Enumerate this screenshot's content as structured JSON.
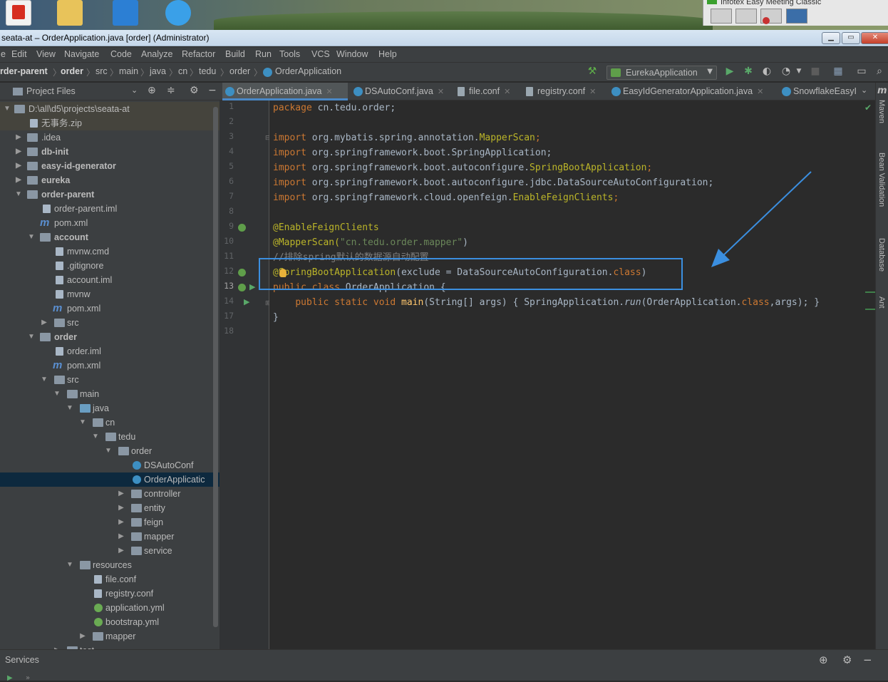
{
  "window": {
    "title": "seata-at – OrderApplication.java [order] (Administrator)",
    "meeting_app_title": "Infotex Easy Meeting Classic"
  },
  "menu": [
    "e",
    "Edit",
    "View",
    "Navigate",
    "Code",
    "Analyze",
    "Refactor",
    "Build",
    "Run",
    "Tools",
    "VCS",
    "Window",
    "Help"
  ],
  "breadcrumb": [
    "rder-parent",
    "order",
    "src",
    "main",
    "java",
    "cn",
    "tedu",
    "order",
    "OrderApplication"
  ],
  "run_config": "EurekaApplication",
  "project_panel": {
    "title": "Project Files"
  },
  "tabs": [
    "OrderApplication.java",
    "DSAutoConf.java",
    "file.conf",
    "registry.conf",
    "EasyIdGeneratorApplication.java",
    "SnowflakeEasyI"
  ],
  "tree": [
    {
      "label": "D:\\all\\d5\\projects\\seata-at",
      "bold": false
    },
    {
      "label": "无事务.zip",
      "bold": false
    },
    {
      "label": ".idea",
      "bold": false
    },
    {
      "label": "db-init",
      "bold": true
    },
    {
      "label": "easy-id-generator",
      "bold": true
    },
    {
      "label": "eureka",
      "bold": true
    },
    {
      "label": "order-parent",
      "bold": true
    },
    {
      "label": "order-parent.iml",
      "bold": false
    },
    {
      "label": "pom.xml",
      "bold": false
    },
    {
      "label": "account",
      "bold": true
    },
    {
      "label": "mvnw.cmd",
      "bold": false
    },
    {
      "label": ".gitignore",
      "bold": false
    },
    {
      "label": "account.iml",
      "bold": false
    },
    {
      "label": "mvnw",
      "bold": false
    },
    {
      "label": "pom.xml",
      "bold": false
    },
    {
      "label": "src",
      "bold": false
    },
    {
      "label": "order",
      "bold": true
    },
    {
      "label": "order.iml",
      "bold": false
    },
    {
      "label": "pom.xml",
      "bold": false
    },
    {
      "label": "src",
      "bold": false
    },
    {
      "label": "main",
      "bold": false
    },
    {
      "label": "java",
      "bold": false
    },
    {
      "label": "cn",
      "bold": false
    },
    {
      "label": "tedu",
      "bold": false
    },
    {
      "label": "order",
      "bold": false
    },
    {
      "label": "DSAutoConf",
      "bold": false
    },
    {
      "label": "OrderApplicatic",
      "bold": false
    },
    {
      "label": "controller",
      "bold": false
    },
    {
      "label": "entity",
      "bold": false
    },
    {
      "label": "feign",
      "bold": false
    },
    {
      "label": "mapper",
      "bold": false
    },
    {
      "label": "service",
      "bold": false
    },
    {
      "label": "resources",
      "bold": false
    },
    {
      "label": "file.conf",
      "bold": false
    },
    {
      "label": "registry.conf",
      "bold": false
    },
    {
      "label": "application.yml",
      "bold": false
    },
    {
      "label": "bootstrap.yml",
      "bold": false
    },
    {
      "label": "mapper",
      "bold": false
    },
    {
      "label": "test",
      "bold": false
    }
  ],
  "line_numbers": [
    "1",
    "2",
    "3",
    "4",
    "5",
    "6",
    "7",
    "8",
    "9",
    "10",
    "11",
    "12",
    "13",
    "14",
    "17",
    "18"
  ],
  "code": {
    "l1_kw": "package ",
    "l1_rest": "cn.tedu.order;",
    "l3_kw": "import ",
    "l3_a": "org.mybatis.spring.annotation.",
    "l3_b": "MapperScan",
    "l3_c": ";",
    "l4_kw": "import ",
    "l4_a": "org.springframework.boot.SpringApplication;",
    "l5_kw": "import ",
    "l5_a": "org.springframework.boot.autoconfigure.",
    "l5_b": "SpringBootApplication",
    "l5_c": ";",
    "l6_kw": "import ",
    "l6_a": "org.springframework.boot.autoconfigure.jdbc.DataSourceAutoConfiguration;",
    "l7_kw": "import ",
    "l7_a": "org.springframework.cloud.openfeign.",
    "l7_b": "EnableFeignClients",
    "l7_c": ";",
    "l9": "@EnableFeignClients",
    "l10_a": "@MapperScan(",
    "l10_b": "\"cn.tedu.order.mapper\"",
    "l10_c": ")",
    "l11": "//排除spring默认的数据源自动配置",
    "l12_a": "@SpringBootApplication",
    "l12_b": "(exclude = DataSourceAutoConfiguration.",
    "l12_c": "class",
    "l12_d": ")",
    "l13_kw": "public class ",
    "l13_b": "OrderApplication",
    "l13_c": " {",
    "l14_kw": "public static void ",
    "l14_fn": "main",
    "l14_a": "(String[] args) { SpringApplication.",
    "l14_run": "run",
    "l14_b": "(OrderApplication.",
    "l14_cls": "class",
    "l14_c": ",args); }",
    "l17": "}"
  },
  "right_tools": [
    "Maven",
    "Bean Validation",
    "Database",
    "Ant"
  ],
  "services": {
    "title": "Services"
  }
}
